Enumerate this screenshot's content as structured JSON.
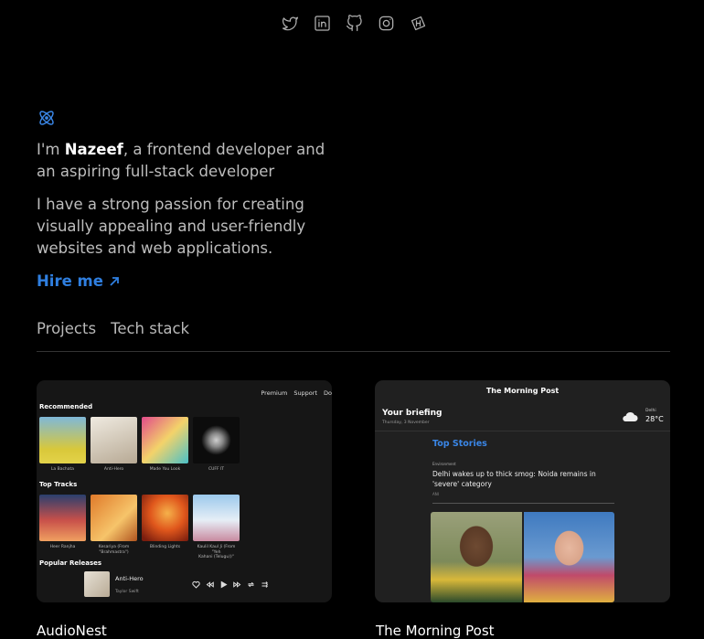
{
  "header": {
    "social_icons": [
      "twitter-icon",
      "linkedin-icon",
      "github-icon",
      "instagram-icon",
      "hashnode-icon"
    ]
  },
  "hero": {
    "logo_icon": "atom-icon",
    "intro_prefix": "I'm ",
    "name": "Nazeef",
    "intro_suffix": ", a frontend developer and an aspiring full-stack developer",
    "bio": "I have a strong passion for creating visually appealing and user-friendly websites and web applications.",
    "hire_label": "Hire me",
    "hire_icon": "arrow-up-right-icon"
  },
  "tabs": [
    {
      "label": "Projects"
    },
    {
      "label": "Tech stack"
    }
  ],
  "projects": [
    {
      "title": "AudioNest",
      "preview": {
        "nav": [
          "Premium",
          "Support",
          "Do"
        ],
        "recommended_heading": "Recommended",
        "recommended": [
          {
            "caption": "La Bachata"
          },
          {
            "caption": "Anti-Hero"
          },
          {
            "caption": "Made You Look"
          },
          {
            "caption": "CUFF IT"
          }
        ],
        "top_tracks_heading": "Top Tracks",
        "top_tracks": [
          {
            "caption": "Heer Ranjha"
          },
          {
            "caption": "Kesariya (From\n\"Brahmastra\")"
          },
          {
            "caption": "Blinding Lights"
          },
          {
            "caption": "Kaulil Kaul Ji (From \"Yeh\nKahani (Telugu))\""
          }
        ],
        "popular_heading": "Popular Releases",
        "player": {
          "title": "Anti-Hero",
          "artist": "Taylor Swift"
        }
      }
    },
    {
      "title": "The Morning Post",
      "preview": {
        "masthead": "The Morning Post",
        "briefing": "Your briefing",
        "date": "Thursday, 3 November",
        "city": "Delhi",
        "temp": "28°C",
        "top_stories": "Top Stories",
        "tag": "Environment",
        "headline": "Delhi wakes up to thick smog: Noida remains in 'severe' category",
        "byline": "ANI"
      }
    }
  ],
  "colors": {
    "background": "#000000",
    "accent": "#2f7fe0",
    "text": "#bdbdbd",
    "card": "#1b1b1b"
  }
}
